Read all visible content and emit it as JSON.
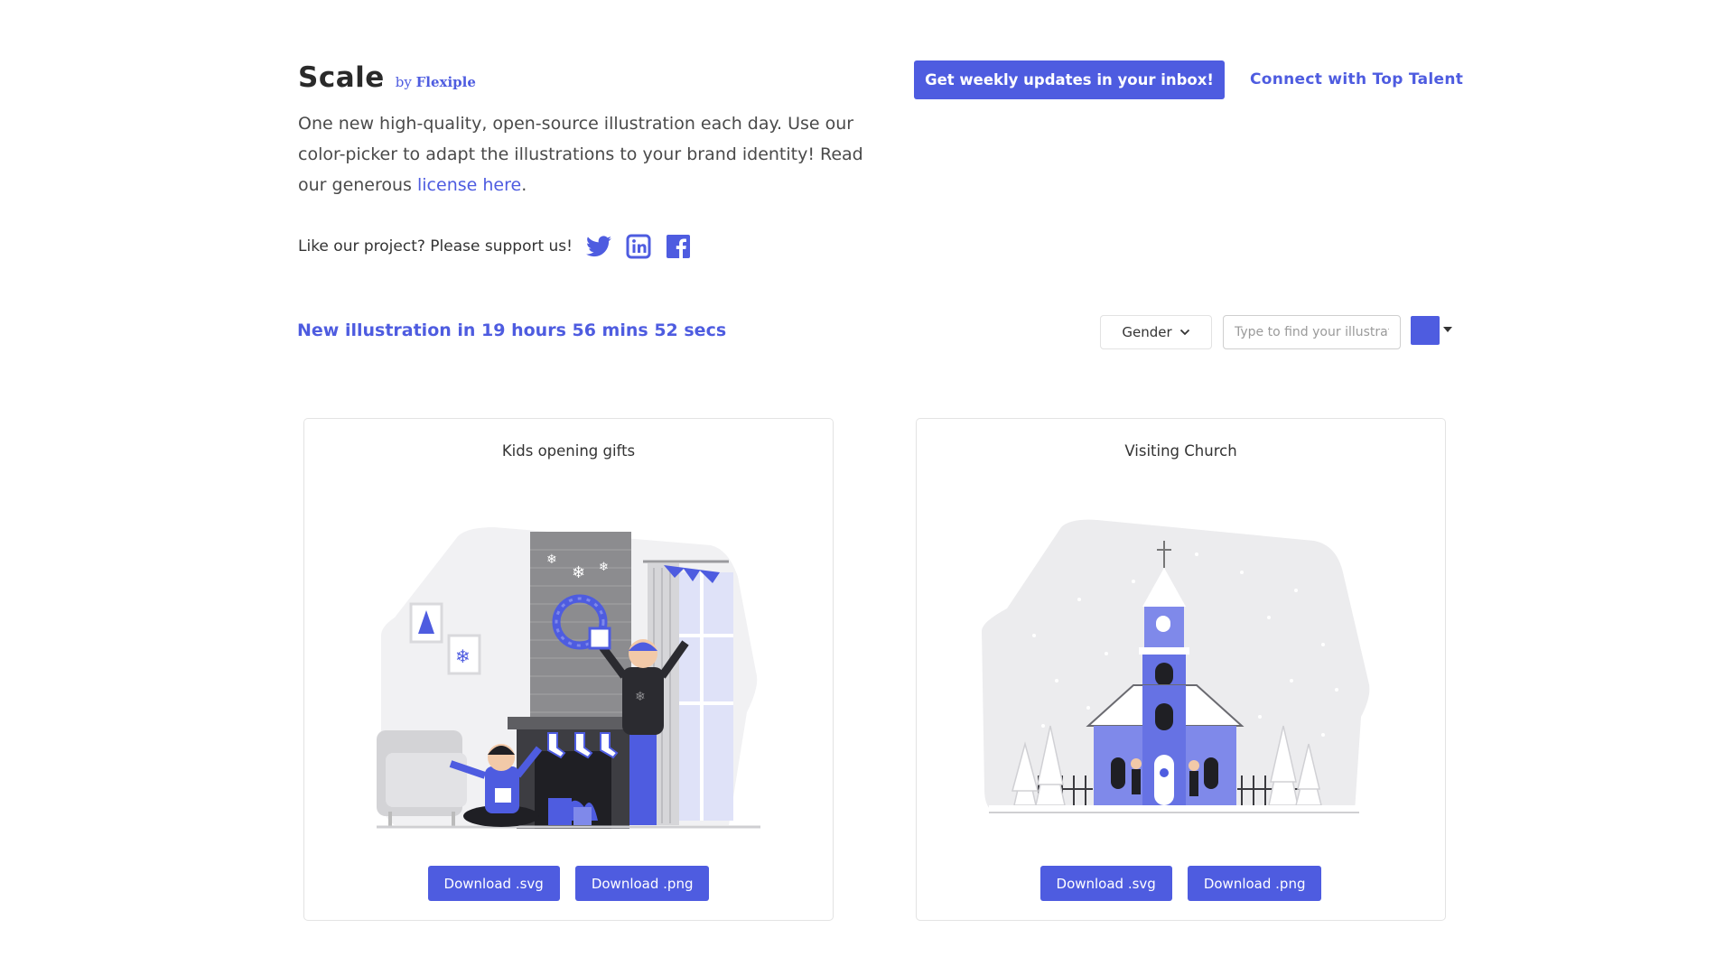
{
  "brand": {
    "title": "Scale",
    "by": "by",
    "company": "Flexiple"
  },
  "intro": {
    "text": "One new high-quality, open-source illustration each day. Use our color-picker to adapt the illustrations to your brand identity! Read our generous ",
    "link": "license here",
    "end": "."
  },
  "support": {
    "text": "Like our project? Please support us!",
    "icons": [
      "twitter-icon",
      "linkedin-icon",
      "facebook-icon"
    ]
  },
  "header": {
    "cta_button": "Get weekly updates in your inbox!",
    "talent_link": "Connect with Top Talent"
  },
  "toolbar": {
    "countdown": "New illustration in 19 hours 56 mins 52 secs",
    "gender_label": "Gender",
    "search_placeholder": "Type to find your illustration",
    "picker_color": "#4e5ce0"
  },
  "cards": [
    {
      "title": "Kids opening gifts",
      "download_svg": "Download .svg",
      "download_png": "Download .png"
    },
    {
      "title": "Visiting Church",
      "download_svg": "Download .svg",
      "download_png": "Download .png"
    }
  ],
  "colors": {
    "accent": "#4e5ce0",
    "text": "#333333",
    "border": "#e3e3e3"
  }
}
